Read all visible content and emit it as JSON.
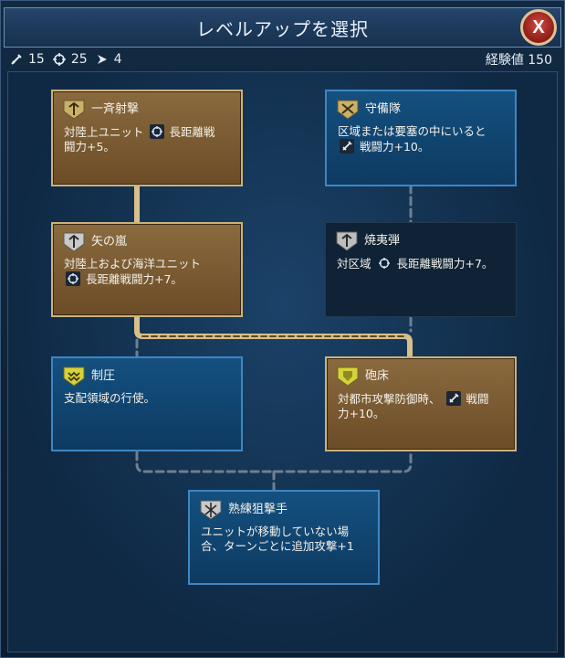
{
  "window": {
    "title": "レベルアップを選択",
    "close_label": "X"
  },
  "stats": {
    "melee": "15",
    "ranged": "25",
    "movement": "4",
    "xp_label": "経験値 150"
  },
  "promotions": {
    "volley": {
      "name": "一斉射撃",
      "desc_1": "対陸上ユニット",
      "desc_2": "長距離戦",
      "desc_3": "闘力+5。"
    },
    "garrison": {
      "name": "守備隊",
      "desc_1": "区域または要塞の中にいると",
      "desc_2": "戦闘力+10。"
    },
    "arrow_storm": {
      "name": "矢の嵐",
      "desc_1": "対陸上および海洋ユニット",
      "desc_2": "長距離戦闘力+7。"
    },
    "incendiaries": {
      "name": "焼夷弾",
      "desc_1": "対区域",
      "desc_2": "長距離戦闘力+7。"
    },
    "suppression": {
      "name": "制圧",
      "desc_1": "支配領域の行使。"
    },
    "emplacement": {
      "name": "砲床",
      "desc_1": "対都市攻撃防御時、",
      "desc_2": "戦闘",
      "desc_3": "力+10。"
    },
    "expert_marksman": {
      "name": "熟練狙撃手",
      "desc_1": "ユニットが移動していない場",
      "desc_2": "合、ターンごとに追加攻撃+1"
    }
  },
  "colors": {
    "gold_border": "#cbb27c",
    "blue_border": "#3f86c2",
    "connector_gold": "#d8c08a",
    "connector_grey": "#6f7f90"
  }
}
